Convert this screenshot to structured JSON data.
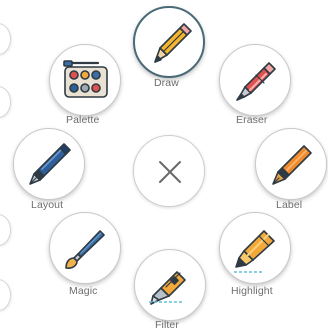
{
  "menu": {
    "tools": [
      {
        "id": "draw",
        "label": "Draw",
        "icon": "pencil-icon",
        "active": true
      },
      {
        "id": "eraser",
        "label": "Eraser",
        "icon": "eraser-pen-icon",
        "active": false
      },
      {
        "id": "label",
        "label": "Label",
        "icon": "fountain-pen-icon",
        "active": false
      },
      {
        "id": "highlight",
        "label": "Highlight",
        "icon": "highlighter-icon",
        "active": false
      },
      {
        "id": "filter",
        "label": "Filter",
        "icon": "utility-knife-icon",
        "active": false
      },
      {
        "id": "magic",
        "label": "Magic",
        "icon": "paintbrush-icon",
        "active": false
      },
      {
        "id": "layout",
        "label": "Layout",
        "icon": "calligraphy-pen-icon",
        "active": false
      },
      {
        "id": "palette",
        "label": "Palette",
        "icon": "paint-palette-icon",
        "active": false
      }
    ],
    "close_icon": "close-icon",
    "colors": {
      "active_ring": "#4a6a78",
      "label_text": "#6e6e6e",
      "outline": "#2e3a44"
    }
  }
}
